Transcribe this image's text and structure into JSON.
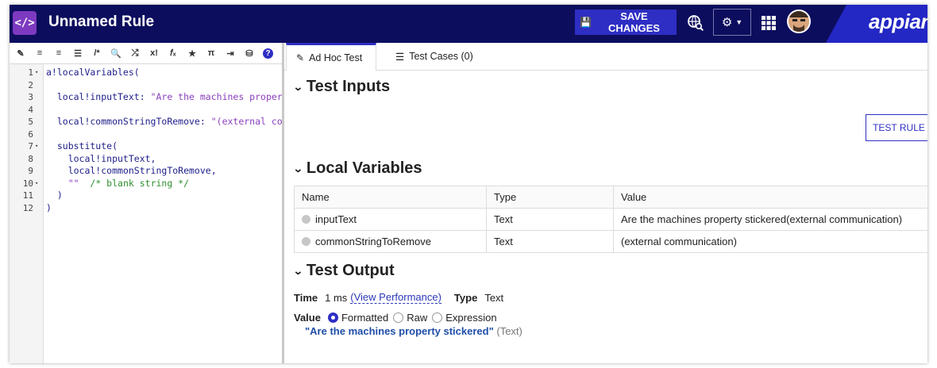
{
  "header": {
    "app_icon": "</>",
    "title": "Unnamed Rule",
    "save_label": "SAVE CHANGES",
    "brand": "appian",
    "colors": {
      "header_bg": "#0d0d5e",
      "accent": "#2e2ec4",
      "app_icon_bg": "#7d3ac1"
    }
  },
  "editor": {
    "toolbar_icons": [
      "magic-format-icon",
      "outdent-icon",
      "indent-icon",
      "list-icon",
      "comment-icon",
      "search-icon",
      "shuffle-icon",
      "exclamation-icon",
      "function-icon",
      "star-icon",
      "pi-icon",
      "export-icon",
      "database-icon",
      "help-icon"
    ],
    "toolbar_glyphs": [
      "✎",
      "≡",
      "≡",
      "☰",
      "/*",
      "🔍",
      "⤮",
      "x!",
      "𝑓ₓ",
      "★",
      "π",
      "⇥",
      "⛁",
      "?"
    ],
    "lines": [
      {
        "n": "1",
        "fold": "▾",
        "text": "a!localVariables("
      },
      {
        "n": "2",
        "fold": "",
        "text": ""
      },
      {
        "n": "3",
        "fold": "",
        "text": "  local!inputText: ",
        "str": "\"Are the machines property stickered(external communication)\""
      },
      {
        "n": "4",
        "fold": "",
        "text": ""
      },
      {
        "n": "5",
        "fold": "",
        "text": "  local!commonStringToRemove: ",
        "str": "\"(external communication)\""
      },
      {
        "n": "6",
        "fold": "",
        "text": ""
      },
      {
        "n": "7",
        "fold": "▾",
        "text": "  substitute("
      },
      {
        "n": "8",
        "fold": "",
        "text": "    local!inputText,"
      },
      {
        "n": "9",
        "fold": "",
        "text": "    local!commonStringToRemove,"
      },
      {
        "n": "10",
        "fold": "▾",
        "text": "    ",
        "str": "\"\"",
        "cmt": "  /* blank string */"
      },
      {
        "n": "11",
        "fold": "",
        "text": "  )"
      },
      {
        "n": "12",
        "fold": "",
        "text": ")"
      }
    ]
  },
  "tabs": [
    {
      "label": "Ad Hoc Test",
      "icon": "edit-icon"
    },
    {
      "label": "Test Cases (0)",
      "icon": "list-icon"
    }
  ],
  "test_inputs": {
    "heading": "Test Inputs",
    "test_rule_label": "TEST RULE"
  },
  "local_variables": {
    "heading": "Local Variables",
    "columns": [
      "Name",
      "Type",
      "Value"
    ],
    "rows": [
      {
        "name": "inputText",
        "type": "Text",
        "value": "Are the machines property stickered(external communication)"
      },
      {
        "name": "commonStringToRemove",
        "type": "Text",
        "value": "(external communication)"
      }
    ]
  },
  "test_output": {
    "heading": "Test Output",
    "time_label": "Time",
    "time_value": "1 ms",
    "view_performance": "(View Performance)",
    "type_label": "Type",
    "type_value": "Text",
    "value_label": "Value",
    "modes": [
      "Formatted",
      "Raw",
      "Expression"
    ],
    "selected_mode": "Formatted",
    "result_string": "\"Are the machines property stickered\"",
    "result_type": "(Text)"
  }
}
